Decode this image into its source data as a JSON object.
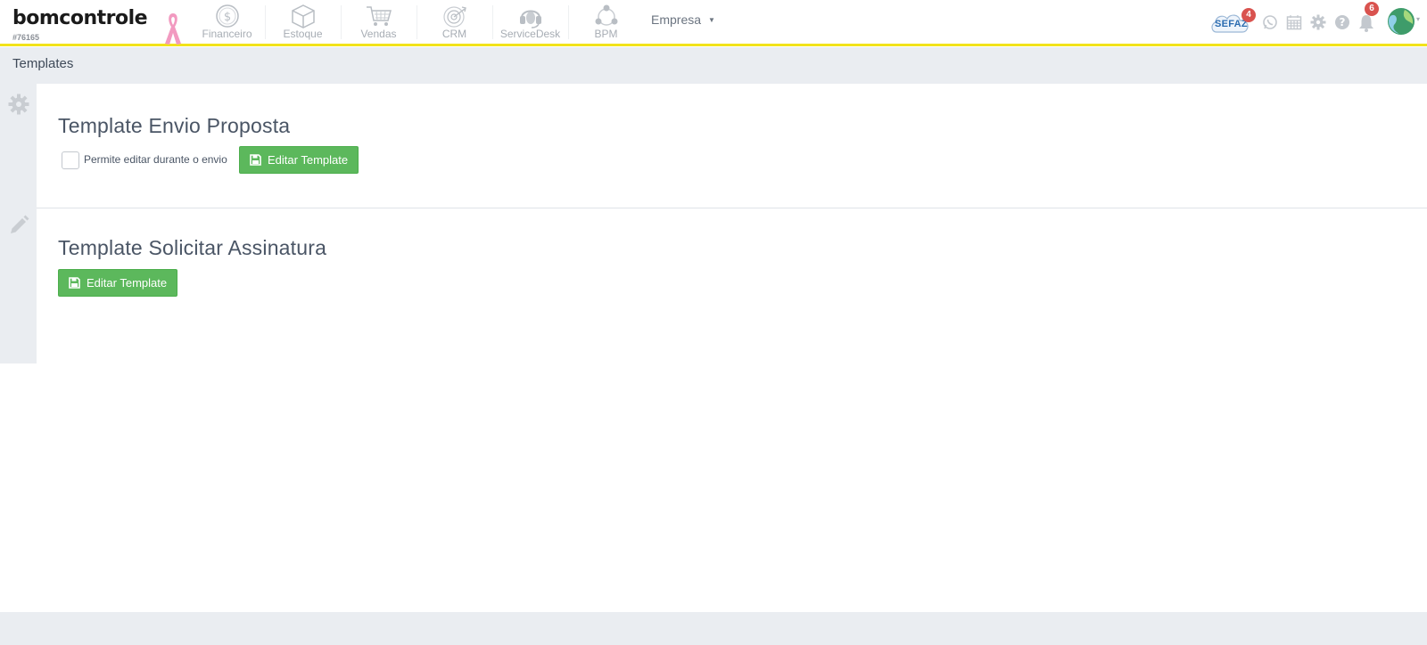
{
  "brand": {
    "logo_text": "bomcontrole",
    "account_id": "#76165"
  },
  "modules": [
    {
      "label": "Financeiro",
      "icon": "dollar-circle-icon"
    },
    {
      "label": "Estoque",
      "icon": "box-icon"
    },
    {
      "label": "Vendas",
      "icon": "cart-icon"
    },
    {
      "label": "CRM",
      "icon": "target-icon"
    },
    {
      "label": "ServiceDesk",
      "icon": "headset-icon"
    },
    {
      "label": "BPM",
      "icon": "network-icon"
    }
  ],
  "company_menu": {
    "label": "Empresa",
    "caret": "▼"
  },
  "header_right": {
    "sefaz_label": "SEFAZ",
    "sefaz_badge": "4",
    "notifications_badge": "6"
  },
  "page": {
    "title": "Templates"
  },
  "sections": [
    {
      "title": "Template Envio Proposta",
      "checkbox_label": "Permite editar durante o envio",
      "button_label": "Editar Template",
      "icon": "gear-icon"
    },
    {
      "title": "Template Solicitar Assinatura",
      "button_label": "Editar Template",
      "icon": "pencil-icon"
    }
  ],
  "colors": {
    "accent_yellow": "#f2e31a",
    "button_green": "#5cb85c",
    "badge_red": "#d9534f",
    "panel_gray": "#eaedf1"
  }
}
